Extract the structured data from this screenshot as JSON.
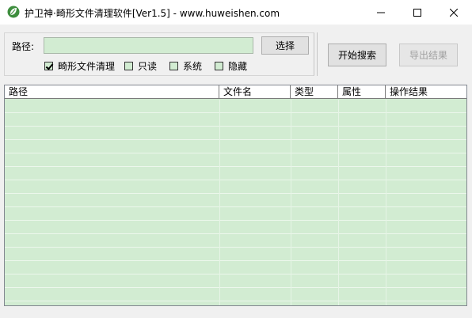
{
  "window": {
    "title": "护卫神·畸形文件清理软件[Ver1.5] - www.huweishen.com",
    "icon": "leaf-shield-icon",
    "controls": {
      "minimize": "minimize-icon",
      "maximize": "maximize-icon",
      "close": "close-icon"
    }
  },
  "form": {
    "path_label": "路径:",
    "path_value": "",
    "select_button": "选择",
    "search_button": "开始搜索",
    "export_button": "导出结果",
    "export_enabled": false
  },
  "checkboxes": [
    {
      "label": "畸形文件清理",
      "checked": true
    },
    {
      "label": "只读",
      "checked": false
    },
    {
      "label": "系统",
      "checked": false
    },
    {
      "label": "隐藏",
      "checked": false
    }
  ],
  "table": {
    "columns": [
      "路径",
      "文件名",
      "类型",
      "属性",
      "操作结果"
    ],
    "rows": []
  },
  "colors": {
    "list_background": "#d2ecd2",
    "window_background": "#f0f0f0",
    "titlebar": "#ffffff"
  }
}
